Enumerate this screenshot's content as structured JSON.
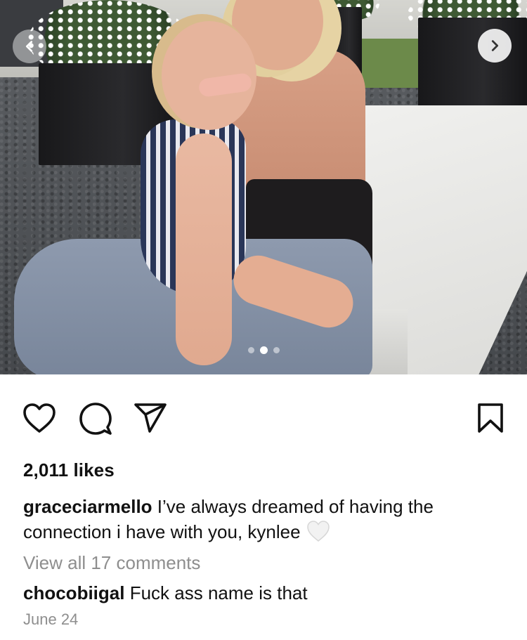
{
  "post": {
    "likes": "2,011 likes",
    "caption_user": "graceciarmello",
    "caption_text": "I’ve always dreamed of having the connection i have with you, kynlee",
    "caption_emoji": "white-heart-icon",
    "view_comments": "View all 17 comments",
    "comment_user": "chocobiigal",
    "comment_text": "Fuck ass name is that",
    "date": "June 24"
  },
  "carousel": {
    "slide_count": 3,
    "active_index": 1,
    "prev_icon": "chevron-left-icon",
    "next_icon": "chevron-right-icon"
  },
  "actions": {
    "like_icon": "heart-outline-icon",
    "comment_icon": "comment-bubble-icon",
    "share_icon": "paper-plane-icon",
    "save_icon": "bookmark-icon"
  },
  "colors": {
    "text": "#111111",
    "muted": "#8e8e8e",
    "background": "#ffffff"
  }
}
